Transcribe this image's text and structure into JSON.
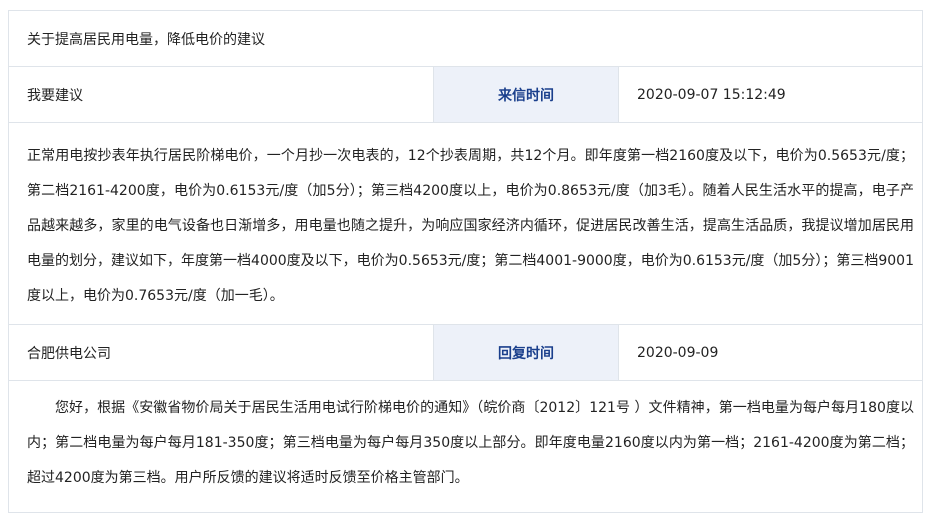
{
  "title": "关于提高居民用电量，降低电价的建议",
  "suggestion": {
    "name": "我要建议",
    "time_label": "来信时间",
    "time_value": "2020-09-07 15:12:49",
    "content": "正常用电按抄表年执行居民阶梯电价，一个月抄一次电表的，12个抄表周期，共12个月。即年度第一档2160度及以下，电价为0.5653元/度；第二档2161-4200度，电价为0.6153元/度（加5分）；第三档4200度以上，电价为0.8653元/度（加3毛）。随着人民生活水平的提高，电子产品越来越多，家里的电气设备也日渐增多，用电量也随之提升，为响应国家经济内循环，促进居民改善生活，提高生活品质，我提议增加居民用电量的划分，建议如下，年度第一档4000度及以下，电价为0.5653元/度；第二档4001-9000度，电价为0.6153元/度（加5分）；第三档9001度以上，电价为0.7653元/度（加一毛）。"
  },
  "reply": {
    "name": "合肥供电公司",
    "time_label": "回复时间",
    "time_value": "2020-09-09",
    "content": "您好，根据《安徽省物价局关于居民生活用电试行阶梯电价的通知》（皖价商〔2012〕121号 ）文件精神，第一档电量为每户每月180度以内；第二档电量为每户每月181-350度；第三档电量为每户每月350度以上部分。即年度电量2160度以内为第一档；2161-4200度为第二档；超过4200度为第三档。用户所反馈的建议将适时反馈至价格主管部门。"
  }
}
